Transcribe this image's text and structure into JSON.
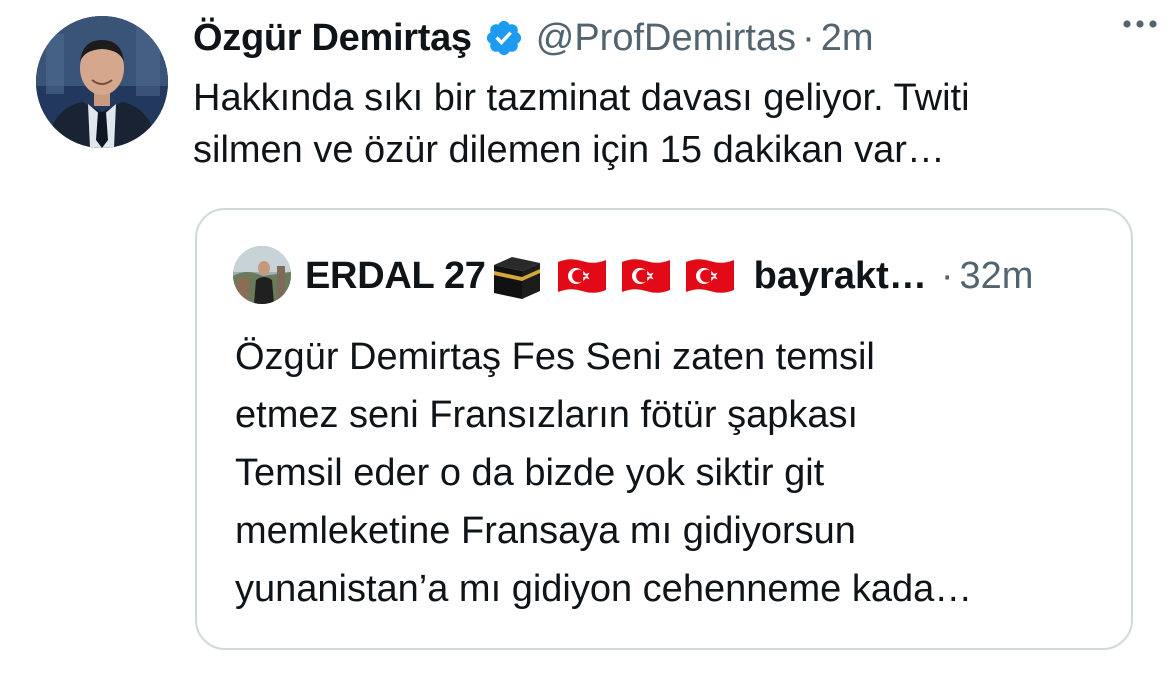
{
  "tweet": {
    "author_name": "Özgür Demirtaş",
    "verified_icon": "verified-badge-icon",
    "handle": "@ProfDemirtas",
    "separator": "·",
    "time": "2m",
    "more_icon": "more-options-icon",
    "text_lines": [
      "Hakkında sıkı bir tazminat davası geliyor. Twiti",
      "silmen ve özür dilemen için 15 dakikan var…"
    ]
  },
  "quoted_tweet": {
    "author_name": "ERDAL 27",
    "emoji_icons": [
      "kaaba-icon",
      "turkey-flag-icon",
      "turkey-flag-icon",
      "turkey-flag-icon"
    ],
    "handle": "bayrakt…",
    "separator": "·",
    "time": "32m",
    "text_lines": [
      "Özgür Demirtaş Fes Seni zaten temsil",
      "etmez seni Fransızların fötür şapkası",
      "Temsil eder o da bizde yok siktir git",
      "memleketine Fransaya mı gidiyorsun",
      "yunanistan’a mı gidiyon cehenneme kada…"
    ]
  },
  "colors": {
    "primary_text": "#0f1419",
    "secondary_text": "#536471",
    "verified_blue": "#1d9bf0",
    "border": "#cfd9de",
    "flag_red": "#e30a17"
  }
}
